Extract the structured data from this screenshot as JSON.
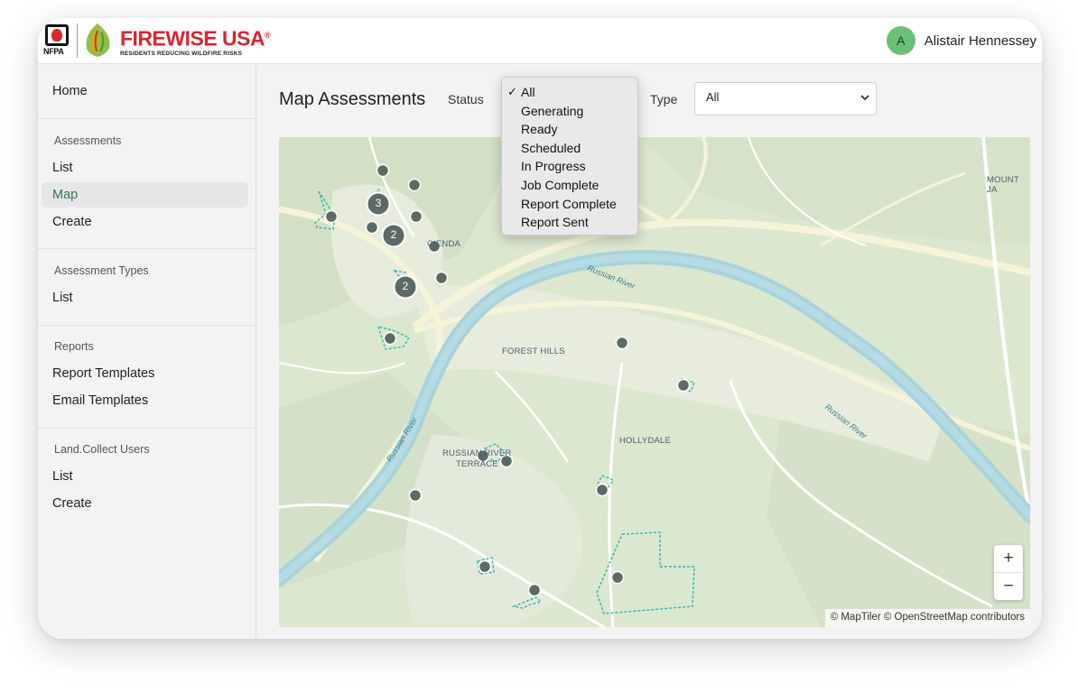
{
  "header": {
    "nfpa_logo_text": "NFPA",
    "brand_title": "FIREWISE USA",
    "brand_mark": "®",
    "brand_tagline": "RESIDENTS REDUCING WILDFIRE RISKS",
    "user": {
      "initial": "A",
      "name": "Alistair Hennessey"
    }
  },
  "sidebar": {
    "home": "Home",
    "sections": [
      {
        "title": "Assessments",
        "items": [
          "List",
          "Map",
          "Create"
        ]
      },
      {
        "title": "Assessment Types",
        "items": [
          "List"
        ]
      },
      {
        "title": "Reports",
        "items": [
          "Report Templates",
          "Email Templates"
        ]
      },
      {
        "title": "Land.Collect Users",
        "items": [
          "List",
          "Create"
        ]
      }
    ],
    "active_item": "Map"
  },
  "main": {
    "title": "Map Assessments",
    "status_label": "Status",
    "type_label": "Type",
    "type_value": "All",
    "status_dropdown": {
      "selected": "All",
      "check_glyph": "✓",
      "options": [
        "All",
        "Generating",
        "Ready",
        "Scheduled",
        "In Progress",
        "Job Complete",
        "Report Complete",
        "Report Sent"
      ]
    }
  },
  "map": {
    "places": {
      "mount": "MOUNT JA",
      "hacienda": "CIENDA",
      "forest_hills": "FOREST HILLS",
      "hollydale": "HOLLYDALE",
      "russian_river_terrace_1": "RUSSIAN RIVER",
      "russian_river_terrace_2": "TERRACE"
    },
    "river_labels": [
      "Russian River",
      "Russian River",
      "Russian River"
    ],
    "clusters": [
      "3",
      "2",
      "2"
    ],
    "zoom_in": "+",
    "zoom_out": "−",
    "attribution": "© MapTiler © OpenStreetMap contributors",
    "colors": {
      "land": "#dce7d0",
      "river": "#a9d3dc",
      "road": "#f6f4d8",
      "marker": "#5c6a65",
      "boundary": "#2bb5b0"
    }
  }
}
